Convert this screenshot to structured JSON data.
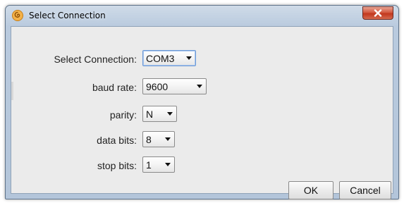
{
  "window": {
    "title": "Select Connection",
    "app_icon": "spiral-app-icon",
    "close_icon": "close-icon"
  },
  "form": {
    "connection": {
      "label": "Select Connection:",
      "value": "COM3"
    },
    "baud_rate": {
      "label": "baud rate:",
      "value": "9600"
    },
    "parity": {
      "label": "parity:",
      "value": "N"
    },
    "data_bits": {
      "label": "data bits:",
      "value": "8"
    },
    "stop_bits": {
      "label": "stop bits:",
      "value": "1"
    }
  },
  "buttons": {
    "ok": "OK",
    "cancel": "Cancel"
  },
  "colors": {
    "titlebar": "#b9cade",
    "client_bg": "#ebebeb",
    "close_button": "#c2371d",
    "focus_border": "#6d9ad6"
  }
}
